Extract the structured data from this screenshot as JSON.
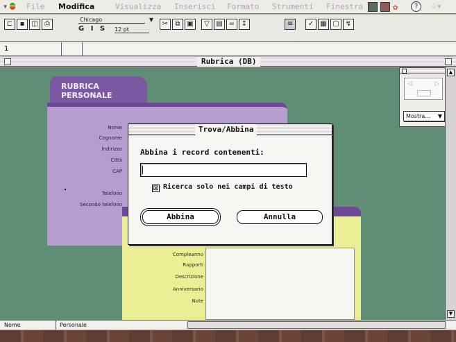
{
  "menubar": {
    "items": [
      {
        "label": "File",
        "active": false
      },
      {
        "label": "Modifica",
        "active": true
      },
      {
        "label": "Visualizza",
        "active": false
      },
      {
        "label": "Inserisci",
        "active": false
      },
      {
        "label": "Formato",
        "active": false
      },
      {
        "label": "Strumenti",
        "active": false
      },
      {
        "label": "Finestra",
        "active": false
      }
    ],
    "help_label": "?"
  },
  "toolbar": {
    "font_name": "Chicago",
    "style_buttons": "G I S",
    "font_size": "12 pt"
  },
  "formula": {
    "cell_ref": "1"
  },
  "window": {
    "title": "Rubrica (DB)"
  },
  "card": {
    "title_line1": "RUBRICA",
    "title_line2": "PERSONALE",
    "fields": [
      "Nome",
      "Cognome",
      "Indirizzo",
      "Città",
      "CAP",
      "Telefono",
      "Secondo telefono"
    ],
    "lower_fields": [
      "Compleanno",
      "Rapporti",
      "Descrizione",
      "Anniversario",
      "Note"
    ]
  },
  "palette": {
    "mostra_label": "Mostra..."
  },
  "status": {
    "field_name": "Nome",
    "layout_name": "Personale"
  },
  "dialog": {
    "title": "Trova/Abbina",
    "prompt": "Abbina i record contenenti:",
    "input_value": "",
    "checkbox_checked": true,
    "checkbox_mark": "⊠",
    "checkbox_label": "Ricerca solo nei campi di testo",
    "ok_label": "Abbina",
    "cancel_label": "Annulla"
  },
  "colors": {
    "canvas": "#5f8d76",
    "card": "#b59dd0",
    "card_tab": "#7a58a2",
    "lower_card": "#ebee95",
    "menu_disabled": "#b4a2b9"
  }
}
